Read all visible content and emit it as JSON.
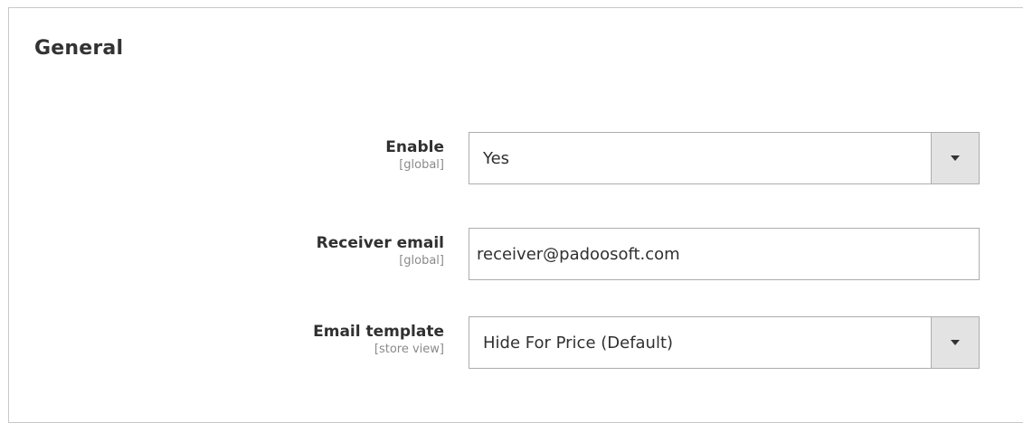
{
  "section": {
    "title": "General"
  },
  "fields": {
    "enable": {
      "label": "Enable",
      "scope": "[global]",
      "value": "Yes"
    },
    "receiver_email": {
      "label": "Receiver email",
      "scope": "[global]",
      "value": "receiver@padoosoft.com"
    },
    "email_template": {
      "label": "Email template",
      "scope": "[store view]",
      "value": "Hide For Price (Default)"
    }
  },
  "icons": {
    "select_arrow": "chevron-down-icon"
  }
}
